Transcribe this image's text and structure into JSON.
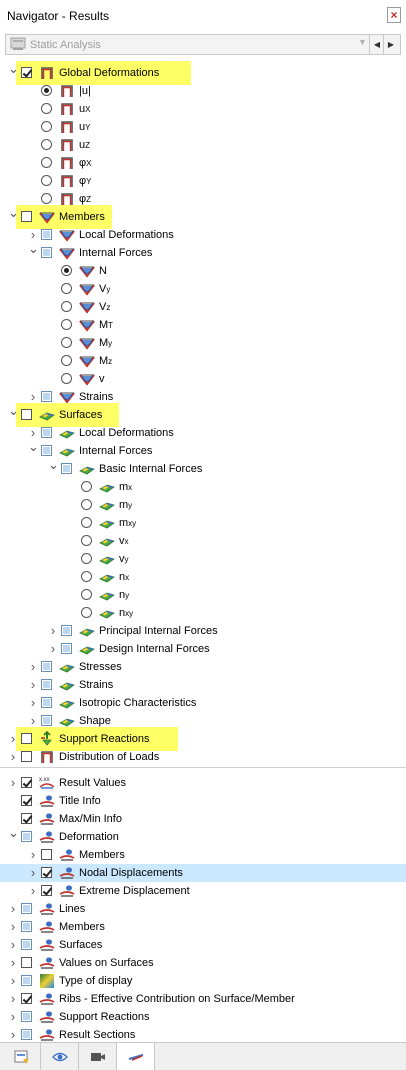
{
  "window": {
    "title": "Navigator - Results",
    "close_glyph": "×"
  },
  "combo": {
    "value": "Static Analysis"
  },
  "tree": [
    {
      "label": "Global Deformations",
      "exp": "down",
      "ctl": "cb-chk",
      "icon": "frame-icon",
      "level": 0,
      "bold": false,
      "hl": true
    },
    {
      "label": "|u|",
      "ctl": "rb-on",
      "icon": "frame-icon",
      "level": 1
    },
    {
      "label": "u",
      "sub": "X",
      "ctl": "rb",
      "icon": "frame-icon",
      "level": 1
    },
    {
      "label": "u",
      "sub": "Y",
      "ctl": "rb",
      "icon": "frame-icon",
      "level": 1
    },
    {
      "label": "u",
      "sub": "Z",
      "ctl": "rb",
      "icon": "frame-icon",
      "level": 1
    },
    {
      "label": "φ",
      "sub": "X",
      "ctl": "rb",
      "icon": "frame-icon",
      "level": 1
    },
    {
      "label": "φ",
      "sub": "Y",
      "ctl": "rb",
      "icon": "frame-icon",
      "level": 1
    },
    {
      "label": "φ",
      "sub": "Z",
      "ctl": "rb",
      "icon": "frame-icon",
      "level": 1
    },
    {
      "label": "Members",
      "exp": "down",
      "ctl": "cb",
      "icon": "member-icon",
      "level": 0,
      "hl": true
    },
    {
      "label": "Local Deformations",
      "exp": "right",
      "ctl": "cb-part",
      "icon": "member-icon",
      "level": 1
    },
    {
      "label": "Internal Forces",
      "exp": "down",
      "ctl": "cb-part",
      "icon": "member-icon",
      "level": 1
    },
    {
      "label": "N",
      "ctl": "rb-on",
      "icon": "member-icon",
      "level": 2
    },
    {
      "label": "V",
      "sub": "y",
      "ctl": "rb",
      "icon": "member-icon",
      "level": 2
    },
    {
      "label": "V",
      "sub": "z",
      "ctl": "rb",
      "icon": "member-icon",
      "level": 2
    },
    {
      "label": "M",
      "sub": "T",
      "ctl": "rb",
      "icon": "member-icon",
      "level": 2
    },
    {
      "label": "M",
      "sub": "y",
      "ctl": "rb",
      "icon": "member-icon",
      "level": 2
    },
    {
      "label": "M",
      "sub": "z",
      "ctl": "rb",
      "icon": "member-icon",
      "level": 2
    },
    {
      "label": "v",
      "ctl": "rb",
      "icon": "member-icon",
      "level": 2
    },
    {
      "label": "Strains",
      "exp": "right",
      "ctl": "cb-part",
      "icon": "member-icon",
      "level": 1
    },
    {
      "label": "Surfaces",
      "exp": "down",
      "ctl": "cb",
      "icon": "surface-icon",
      "level": 0,
      "hl": true
    },
    {
      "label": "Local Deformations",
      "exp": "right",
      "ctl": "cb-part",
      "icon": "surface-icon",
      "level": 1
    },
    {
      "label": "Internal Forces",
      "exp": "down",
      "ctl": "cb-part",
      "icon": "surface-icon",
      "level": 1
    },
    {
      "label": "Basic Internal Forces",
      "exp": "down",
      "ctl": "cb-part",
      "icon": "surface-icon",
      "level": 2
    },
    {
      "label": "m",
      "sub": "x",
      "ctl": "rb",
      "icon": "surface-icon",
      "level": 3
    },
    {
      "label": "m",
      "sub": "y",
      "ctl": "rb",
      "icon": "surface-icon",
      "level": 3
    },
    {
      "label": "m",
      "sub": "xy",
      "ctl": "rb",
      "icon": "surface-icon",
      "level": 3
    },
    {
      "label": "v",
      "sub": "x",
      "ctl": "rb",
      "icon": "surface-icon",
      "level": 3
    },
    {
      "label": "v",
      "sub": "y",
      "ctl": "rb",
      "icon": "surface-icon",
      "level": 3
    },
    {
      "label": "n",
      "sub": "x",
      "ctl": "rb",
      "icon": "surface-icon",
      "level": 3
    },
    {
      "label": "n",
      "sub": "y",
      "ctl": "rb",
      "icon": "surface-icon",
      "level": 3
    },
    {
      "label": "n",
      "sub": "xy",
      "ctl": "rb",
      "icon": "surface-icon",
      "level": 3
    },
    {
      "label": "Principal Internal Forces",
      "exp": "right",
      "ctl": "cb-part",
      "icon": "surface-icon",
      "level": 2
    },
    {
      "label": "Design Internal Forces",
      "exp": "right",
      "ctl": "cb-part",
      "icon": "surface-icon",
      "level": 2
    },
    {
      "label": "Stresses",
      "exp": "right",
      "ctl": "cb-part",
      "icon": "surface-icon",
      "level": 1
    },
    {
      "label": "Strains",
      "exp": "right",
      "ctl": "cb-part",
      "icon": "surface-icon",
      "level": 1
    },
    {
      "label": "Isotropic Characteristics",
      "exp": "right",
      "ctl": "cb-part",
      "icon": "surface-icon",
      "level": 1
    },
    {
      "label": "Shape",
      "exp": "right",
      "ctl": "cb-part",
      "icon": "surface-icon",
      "level": 1
    },
    {
      "label": "Support Reactions",
      "exp": "right",
      "ctl": "cb",
      "icon": "support-icon",
      "level": 0,
      "hl": true
    },
    {
      "label": "Distribution of Loads",
      "exp": "right",
      "ctl": "cb",
      "icon": "frame-icon",
      "level": 0
    },
    {
      "label": "Result Values",
      "exp": "right",
      "ctl": "cb-chk",
      "icon": "values-icon",
      "level": 0,
      "sep": true
    },
    {
      "label": "Title Info",
      "ctl": "cb-chk",
      "icon": "display-icon",
      "level": 0
    },
    {
      "label": "Max/Min Info",
      "ctl": "cb-chk",
      "icon": "display-icon",
      "level": 0
    },
    {
      "label": "Deformation",
      "exp": "down",
      "ctl": "cb-part",
      "icon": "display-icon",
      "level": 0
    },
    {
      "label": "Members",
      "exp": "right",
      "ctl": "cb",
      "icon": "display-icon",
      "level": 1
    },
    {
      "label": "Nodal Displacements",
      "exp": "right",
      "ctl": "cb-chk",
      "icon": "display-icon",
      "level": 1,
      "selected": true
    },
    {
      "label": "Extreme Displacement",
      "exp": "right",
      "ctl": "cb-chk",
      "icon": "display-icon",
      "level": 1
    },
    {
      "label": "Lines",
      "exp": "right",
      "ctl": "cb-part",
      "icon": "display-icon",
      "level": 0
    },
    {
      "label": "Members",
      "exp": "right",
      "ctl": "cb-part",
      "icon": "display-icon",
      "level": 0
    },
    {
      "label": "Surfaces",
      "exp": "right",
      "ctl": "cb-part",
      "icon": "display-icon",
      "level": 0
    },
    {
      "label": "Values on Surfaces",
      "exp": "right",
      "ctl": "cb",
      "icon": "display-icon",
      "level": 0
    },
    {
      "label": "Type of display",
      "exp": "right",
      "ctl": "cb-part",
      "icon": "color-icon",
      "level": 0
    },
    {
      "label": "Ribs - Effective Contribution on Surface/Member",
      "exp": "right",
      "ctl": "cb-chk",
      "icon": "display-icon",
      "level": 0
    },
    {
      "label": "Support Reactions",
      "exp": "right",
      "ctl": "cb-part",
      "icon": "display-icon",
      "level": 0
    },
    {
      "label": "Result Sections",
      "exp": "right",
      "ctl": "cb-part",
      "icon": "display-icon",
      "level": 0
    }
  ],
  "tabs": [
    {
      "name": "data-tab",
      "icon": "data-icon"
    },
    {
      "name": "view-tab",
      "icon": "eye-icon"
    },
    {
      "name": "camera-tab",
      "icon": "camera-icon"
    },
    {
      "name": "results-tab",
      "icon": "results-icon",
      "active": true
    }
  ],
  "colors": {
    "highlight": "#ffff66",
    "selection": "#cce8ff",
    "icon_red": "#c0322b",
    "icon_blue": "#3a6fc4",
    "surface_green": "#48a848"
  }
}
